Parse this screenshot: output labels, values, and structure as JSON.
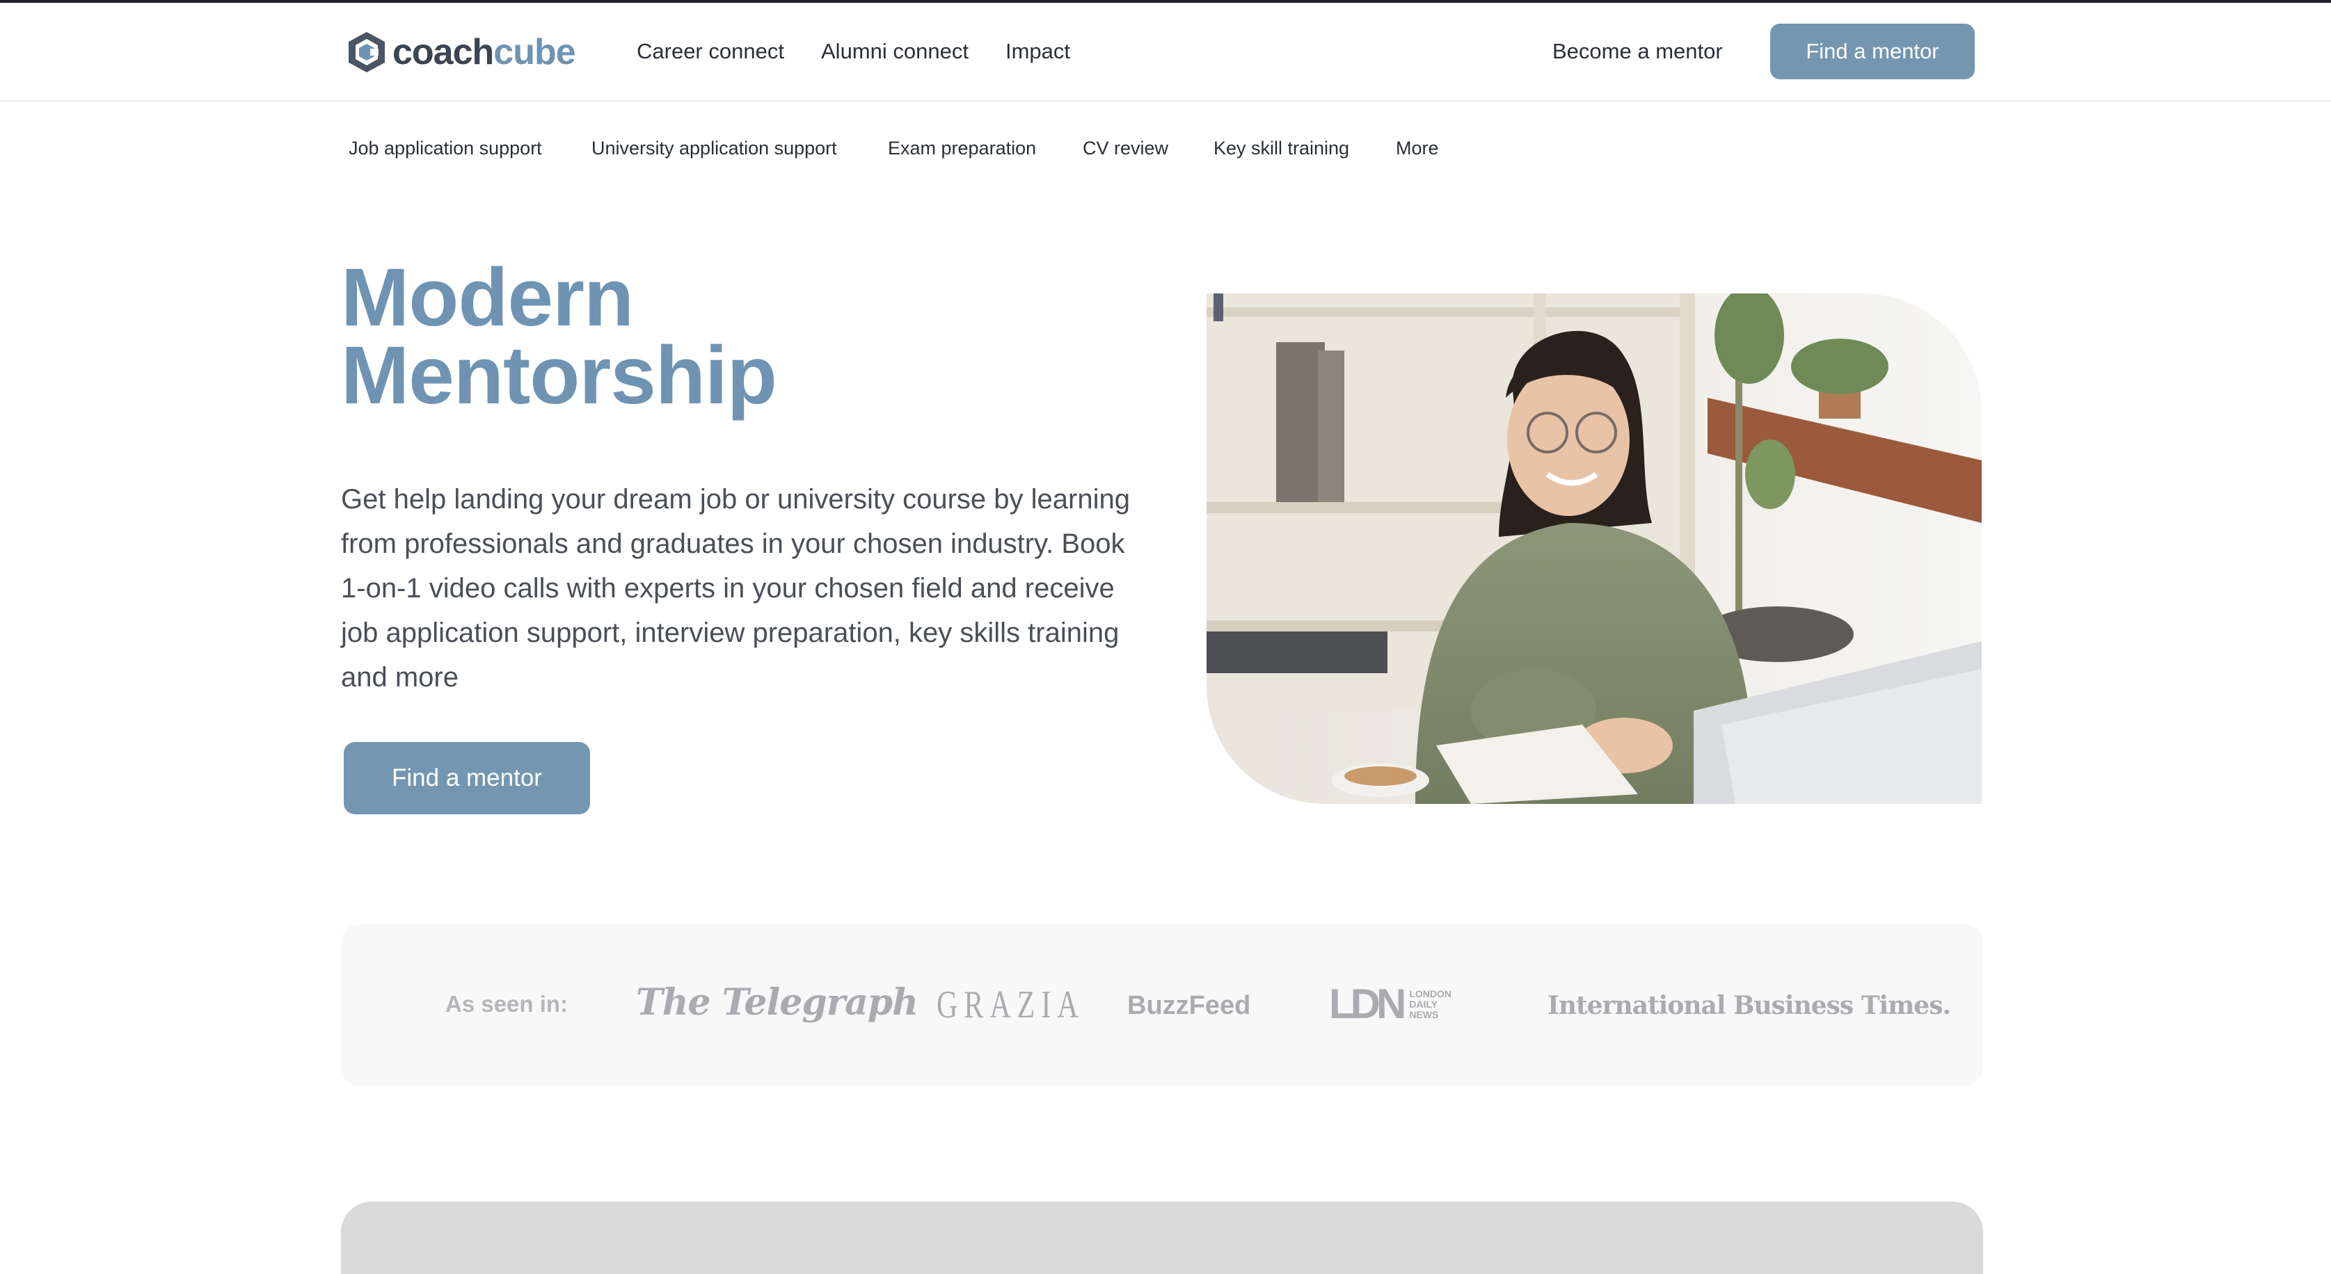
{
  "brand": {
    "name_part1": "coach",
    "name_part2": "cube",
    "accent_color": "#7596b1",
    "title_color": "#6f93b2"
  },
  "header": {
    "nav": [
      "Career connect",
      "Alumni connect",
      "Impact"
    ],
    "become_mentor": "Become a mentor",
    "find_mentor": "Find a mentor"
  },
  "subnav": [
    "Job application support",
    "University application support",
    "Exam preparation",
    "CV review",
    "Key skill training",
    "More"
  ],
  "hero": {
    "title_line1": "Modern",
    "title_line2": "Mentorship",
    "description": "Get help landing your dream job or university course by learning from professionals and graduates in your chosen industry. Book 1-on-1 video calls with experts in your chosen field and receive job application support, interview preparation, key skills training and more",
    "cta": "Find a mentor",
    "image_icon": "student-with-laptop-photo"
  },
  "press": {
    "label": "As seen in:",
    "logos": [
      "The Telegraph",
      "GRAZIA",
      "BuzzFeed",
      "LDN",
      "International Business Times"
    ],
    "ldn_sub": [
      "LONDON",
      "DAILY",
      "NEWS"
    ],
    "ibt_suffix": "."
  }
}
